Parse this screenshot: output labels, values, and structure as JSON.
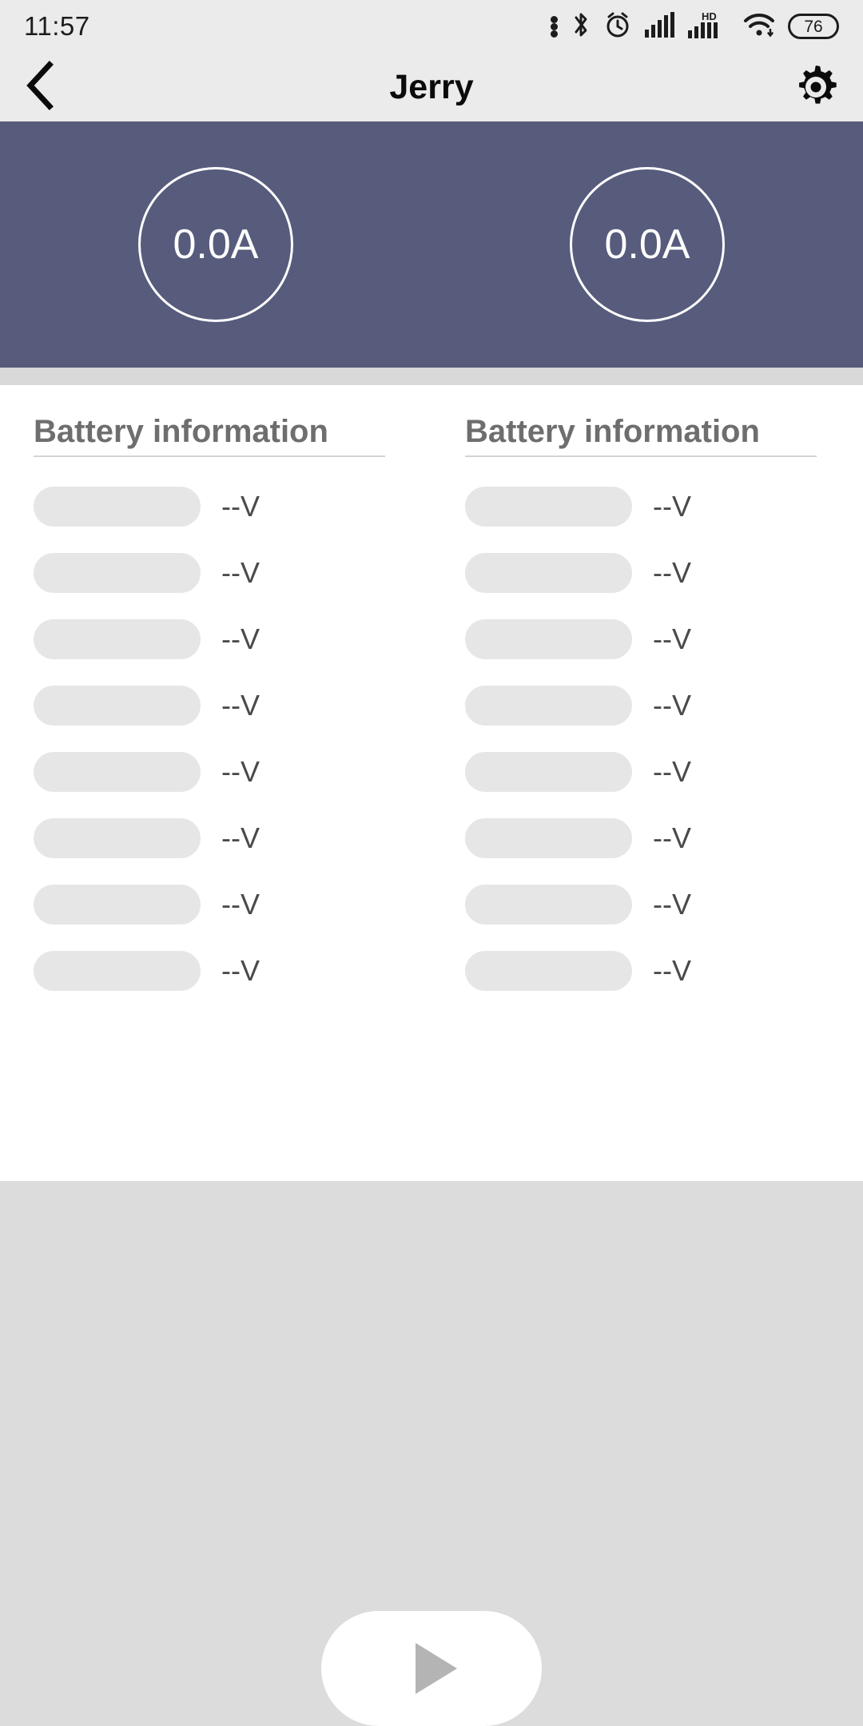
{
  "status_bar": {
    "time": "11:57",
    "icons": [
      {
        "name": "notification-dots-icon"
      },
      {
        "name": "bluetooth-icon"
      },
      {
        "name": "alarm-clock-icon"
      },
      {
        "name": "cellular-signal-icon"
      },
      {
        "name": "hd-volte-signal-icon",
        "label": "HD"
      },
      {
        "name": "wifi-icon"
      }
    ],
    "battery_level": "76"
  },
  "app_bar": {
    "back_icon": "chevron-left-icon",
    "title": "Jerry",
    "settings_icon": "gear-icon"
  },
  "current_panel": {
    "background_color": "#575b7c",
    "gauges": [
      {
        "value": "0.0A"
      },
      {
        "value": "0.0A"
      }
    ]
  },
  "battery_columns": [
    {
      "heading": "Battery information",
      "cells": [
        {
          "voltage": "--V",
          "level_percent": 0
        },
        {
          "voltage": "--V",
          "level_percent": 0
        },
        {
          "voltage": "--V",
          "level_percent": 0
        },
        {
          "voltage": "--V",
          "level_percent": 0
        },
        {
          "voltage": "--V",
          "level_percent": 0
        },
        {
          "voltage": "--V",
          "level_percent": 0
        },
        {
          "voltage": "--V",
          "level_percent": 0
        },
        {
          "voltage": "--V",
          "level_percent": 0
        }
      ]
    },
    {
      "heading": "Battery information",
      "cells": [
        {
          "voltage": "--V",
          "level_percent": 0
        },
        {
          "voltage": "--V",
          "level_percent": 0
        },
        {
          "voltage": "--V",
          "level_percent": 0
        },
        {
          "voltage": "--V",
          "level_percent": 0
        },
        {
          "voltage": "--V",
          "level_percent": 0
        },
        {
          "voltage": "--V",
          "level_percent": 0
        },
        {
          "voltage": "--V",
          "level_percent": 0
        },
        {
          "voltage": "--V",
          "level_percent": 0
        }
      ]
    }
  ],
  "nav_bar": {
    "home_icon": "play-triangle-icon"
  },
  "colors": {
    "accent": "#575b7c",
    "card": "#ffffff",
    "page_background": "#dcdcdc",
    "bar_background": "#ebebeb",
    "cell_bar": "#e6e6e6",
    "heading_text": "#6e6e6e"
  }
}
